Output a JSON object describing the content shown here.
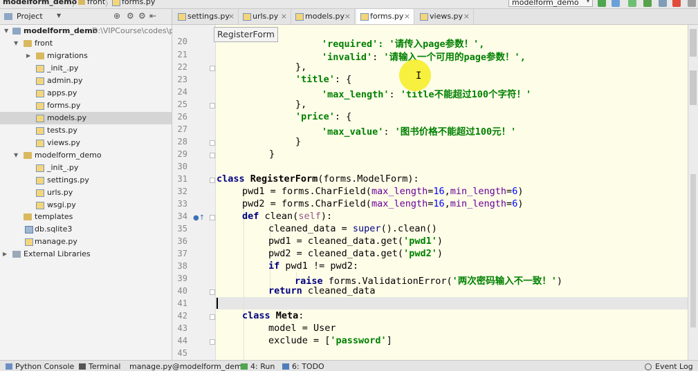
{
  "breadcrumb": {
    "project": "modelform_demo",
    "folder": "front",
    "file": "forms.py"
  },
  "run_config": "modelform_demo",
  "project_panel": {
    "title": "Project",
    "root_name": "modelform_demo",
    "root_path": "D:\\VIPCourse\\codes\\py",
    "items": [
      {
        "label": "front"
      },
      {
        "label": "migrations"
      },
      {
        "label": "_init_.py"
      },
      {
        "label": "admin.py"
      },
      {
        "label": "apps.py"
      },
      {
        "label": "forms.py"
      },
      {
        "label": "models.py"
      },
      {
        "label": "tests.py"
      },
      {
        "label": "views.py"
      },
      {
        "label": "modelform_demo"
      },
      {
        "label": "_init_.py"
      },
      {
        "label": "settings.py"
      },
      {
        "label": "urls.py"
      },
      {
        "label": "wsgi.py"
      },
      {
        "label": "templates"
      },
      {
        "label": "db.sqlite3"
      },
      {
        "label": "manage.py"
      },
      {
        "label": "External Libraries"
      }
    ]
  },
  "tabs": [
    {
      "label": "settings.py"
    },
    {
      "label": "urls.py"
    },
    {
      "label": "models.py"
    },
    {
      "label": "forms.py"
    },
    {
      "label": "views.py"
    }
  ],
  "tooltip": "RegisterForm",
  "line_numbers": [
    "20",
    "21",
    "22",
    "23",
    "24",
    "25",
    "26",
    "27",
    "28",
    "29",
    "30",
    "31",
    "32",
    "33",
    "34",
    "35",
    "36",
    "37",
    "38",
    "39",
    "40",
    "41",
    "42",
    "43",
    "44",
    "45"
  ],
  "code": {
    "l20_str": "'required'",
    "l20_tail": ": '请传入page参数！',",
    "l21_key": "'invalid'",
    "l21_val": "'请输入一个可用的page参数！'",
    "l22": "},",
    "l23_key": "'title'",
    "l23_tail": ": {",
    "l24_key": "'max_length'",
    "l24_val": "'title不能超过100个字符！'",
    "l25": "},",
    "l26_key": "'price'",
    "l26_tail": ": {",
    "l27_key": "'max_value'",
    "l27_val": "'图书价格不能超过100元！'",
    "l28": "}",
    "l29": "}",
    "l31_kw": "class",
    "l31_name": "RegisterForm",
    "l31_rest": "(forms.ModelForm):",
    "l32_a": "pwd1 = forms.CharField(",
    "l32_p1": "max_length",
    "l32_n1": "16",
    "l32_p2": "min_length",
    "l32_n2": "6",
    "l33_a": "pwd2 = forms.CharField(",
    "l33_p1": "max_length",
    "l33_n1": "16",
    "l33_p2": "min_length",
    "l33_n2": "6",
    "l34_kw": "def",
    "l34_fn": "clean",
    "l34_self": "self",
    "l35_a": "cleaned_data = ",
    "l35_bi": "super",
    "l35_b": "().clean()",
    "l36_a": "pwd1 = cleaned_data.get(",
    "l36_s": "'pwd1'",
    "l37_a": "pwd2 = cleaned_data.get(",
    "l37_s": "'pwd2'",
    "l38_kw": "if",
    "l38_rest": " pwd1 != pwd2:",
    "l39_kw": "raise",
    "l39_a": " forms.ValidationError(",
    "l39_s": "'两次密码输入不一致！'",
    "l40_kw": "return",
    "l40_rest": " cleaned_data",
    "l42_kw": "class",
    "l42_name": "Meta",
    "l43_a": "model = User",
    "l44_a": "exclude = [",
    "l44_s": "'password'",
    "l44_b": "]"
  },
  "status_bar": {
    "python_console": "Python Console",
    "terminal": "Terminal",
    "manage": "manage.py@modelform_demo",
    "run": "4: Run",
    "todo": "6: TODO",
    "event_log": "Event Log"
  },
  "colors": {
    "keyword": "#000080",
    "string": "#008000",
    "number": "#0000ff",
    "editor_bg": "#fefde8"
  }
}
